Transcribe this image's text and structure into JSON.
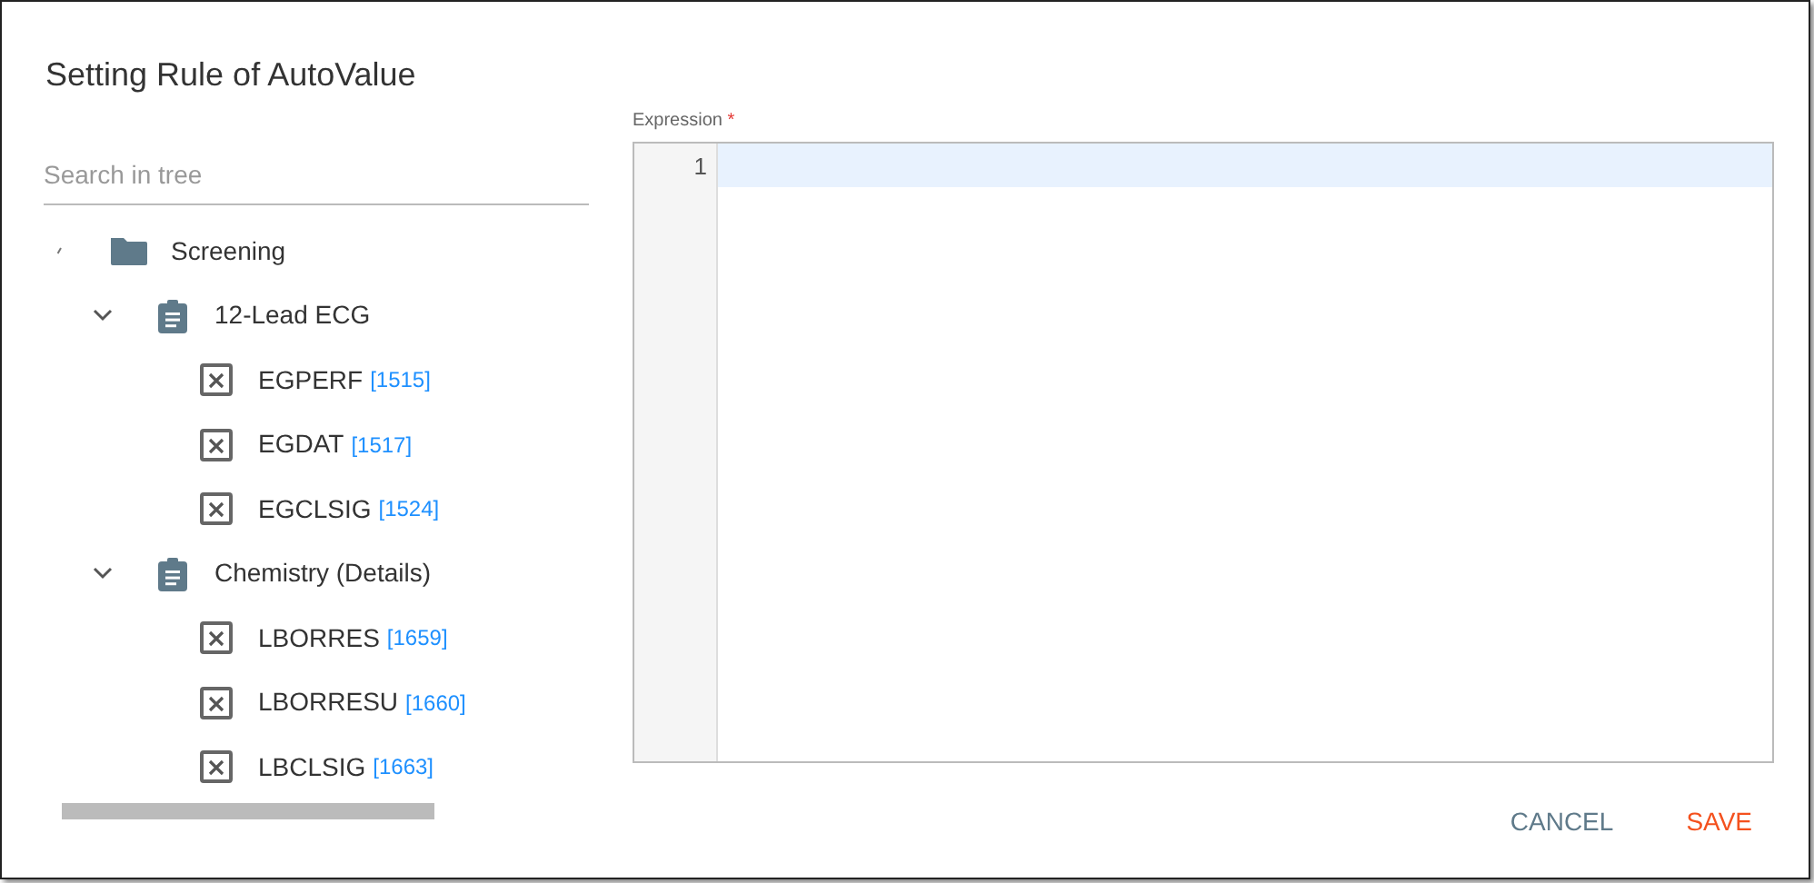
{
  "dialog": {
    "title": "Setting Rule of AutoValue"
  },
  "search": {
    "placeholder": "Search in tree"
  },
  "tree": [
    {
      "kind": "folder",
      "label": "Screening",
      "children": [
        {
          "kind": "form",
          "label": "12-Lead ECG",
          "expanded": true,
          "children": [
            {
              "kind": "field",
              "label": "EGPERF",
              "code": "[1515]"
            },
            {
              "kind": "field",
              "label": "EGDAT",
              "code": "[1517]"
            },
            {
              "kind": "field",
              "label": "EGCLSIG",
              "code": "[1524]"
            }
          ]
        },
        {
          "kind": "form",
          "label": "Chemistry (Details)",
          "expanded": true,
          "children": [
            {
              "kind": "field",
              "label": "LBORRES",
              "code": "[1659]"
            },
            {
              "kind": "field",
              "label": "LBORRESU",
              "code": "[1660]"
            },
            {
              "kind": "field",
              "label": "LBCLSIG",
              "code": "[1663]"
            }
          ]
        }
      ]
    }
  ],
  "expression": {
    "label": "Expression",
    "required": true,
    "required_mark": "*",
    "line_numbers": [
      "1"
    ]
  },
  "buttons": [
    {
      "kind": "cancel",
      "label": "CANCEL"
    },
    {
      "kind": "save",
      "label": "SAVE"
    }
  ]
}
